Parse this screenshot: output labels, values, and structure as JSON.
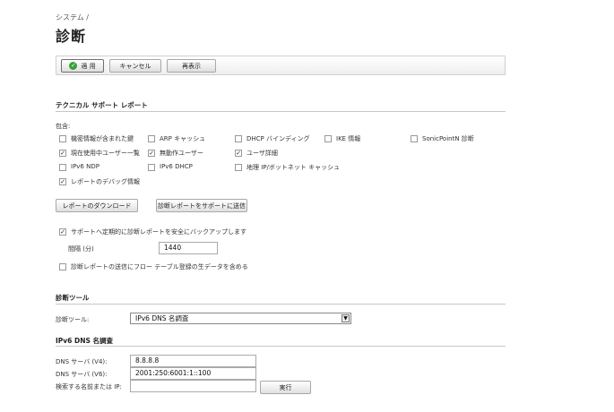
{
  "breadcrumb": "システム /",
  "page_title": "診断",
  "toolbar": {
    "apply_label": "適 用",
    "cancel_label": "キャンセル",
    "refresh_label": "再表示"
  },
  "tsr": {
    "heading": "テクニカル サポート レポート",
    "include_label": "包含:",
    "options": [
      {
        "label": "機密情報が含まれた鍵",
        "checked": false
      },
      {
        "label": "ARP キャッシュ",
        "checked": false
      },
      {
        "label": "DHCP バインディング",
        "checked": false
      },
      {
        "label": "IKE 情報",
        "checked": false
      },
      {
        "label": "SonicPointN 診断",
        "checked": false
      },
      {
        "label": "現在使用中ユーザー一覧",
        "checked": true
      },
      {
        "label": "無動作ユーザー",
        "checked": true
      },
      {
        "label": "ユーザ詳細",
        "checked": true
      },
      {
        "label": "IPv6 NDP",
        "checked": false
      },
      {
        "label": "IPv6 DHCP",
        "checked": false
      },
      {
        "label": "地理 IP/ボットネット キャッシュ",
        "checked": false
      },
      {
        "label": "レポートのデバッグ情報",
        "checked": true
      }
    ],
    "download_button": "レポートのダウンロード",
    "send_button": "診断レポートをサポートに送信",
    "periodic_backup_label": "サポートへ定期的に診断レポートを安全にバックアップします",
    "periodic_backup_checked": true,
    "interval_label": "間隔 (分)",
    "interval_value": "1440",
    "include_flow_label": "診断レポートの送信にフロー テーブル登録の生データを含める",
    "include_flow_checked": false
  },
  "tools": {
    "heading": "診断ツール",
    "tool_label": "診断ツール:",
    "tool_selected": "IPv6 DNS 名調査"
  },
  "dns": {
    "heading": "IPv6 DNS 名調査",
    "server_v4_label": "DNS サーバ (V4):",
    "server_v4_value": "8.8.8.8",
    "server_v6_label": "DNS サーバ (V6):",
    "server_v6_value": "2001:250:6001:1::100",
    "lookup_label": "検索する名前または IP:",
    "lookup_value": "",
    "go_button": "実行"
  }
}
